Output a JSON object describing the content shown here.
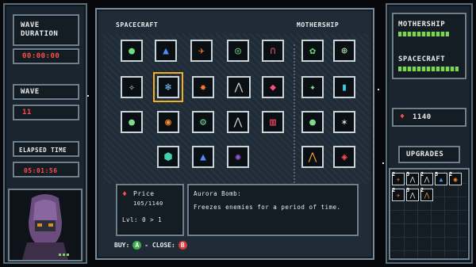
{
  "left_panel": {
    "wave_duration_label": "WAVE\nDURATION",
    "wave_duration_value": "00:00:00",
    "wave_label": "WAVE",
    "wave_value": "11",
    "elapsed_label": "ELAPSED TIME",
    "elapsed_value": "05:01:56"
  },
  "shop": {
    "spacecraft_header": "SPACECRAFT",
    "mothership_header": "MOTHERSHIP",
    "spacecraft_rows": [
      [
        "green-orb-icon",
        "blue-flames-icon",
        "rockets-icon",
        "radar-icon",
        "magnet-icon"
      ],
      [
        "wrench-sparkle-icon",
        "snowflake-icon",
        "burst-icon",
        "ship-squad-icon",
        "red-crystals-icon"
      ],
      [
        "wrench-orb-icon",
        "orange-rings-icon",
        "wrench-gear-icon",
        "ship-lasers-icon",
        "striped-shield-icon"
      ],
      [
        "teal-hex-icon",
        "green-flame-icon",
        "purple-vortex-icon"
      ]
    ],
    "mothership_rows": [
      [
        "green-orb-icon",
        "compass-icon"
      ],
      [
        "sparkle-icon",
        "cyan-beam-icon"
      ],
      [
        "wrench-orb-icon",
        "ship-blast-icon"
      ],
      [
        "rocket-volley-icon",
        "red-turret-icon"
      ]
    ],
    "price_label": "Price",
    "price_value": "105/1140",
    "level_text": "Lvl: 0 > 1",
    "item_name": "Aurora Bomb:",
    "item_desc": "Freezes enemies for a period of time.",
    "buy_label": "BUY:",
    "buy_key": "A",
    "close_label": "- CLOSE:",
    "close_key": "B"
  },
  "right_panel": {
    "mothership_label": "MOTHERSHIP",
    "spacecraft_label": "SPACECRAFT",
    "currency_value": "1140",
    "upgrades_label": "UPGRADES",
    "upgrade_icons": [
      {
        "count": "2",
        "icon": "rockets-icon"
      },
      {
        "count": "3",
        "icon": "ship-squad-icon"
      },
      {
        "count": "2",
        "icon": "ship-lasers-icon"
      },
      {
        "count": "3",
        "icon": "blue-flames-icon"
      },
      {
        "count": "2",
        "icon": "orange-rings-icon"
      },
      {
        "count": "2",
        "icon": "rockets-icon"
      },
      {
        "count": "3",
        "icon": "ship-squad-icon"
      },
      {
        "count": "2",
        "icon": "rocket-volley-icon"
      }
    ]
  },
  "colors": {
    "accent": "#f0b020",
    "red": "#ff4d4d",
    "green_bar": "#7dd35c",
    "a_button": "#3fae49",
    "b_button": "#d8383a"
  }
}
